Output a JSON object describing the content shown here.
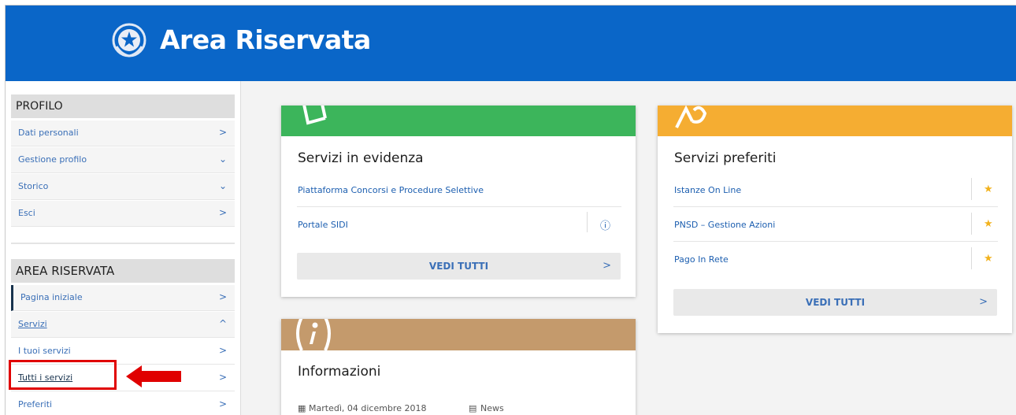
{
  "header": {
    "title": "Area Riservata",
    "bg_color": "#0a66c8",
    "emblem": "italian-republic-emblem-icon"
  },
  "sidebar": {
    "profilo": {
      "heading": "PROFILO",
      "items": [
        {
          "label": "Dati personali",
          "chevron": ">"
        },
        {
          "label": "Gestione profilo",
          "chevron": "⌄"
        },
        {
          "label": "Storico",
          "chevron": "⌄"
        },
        {
          "label": "Esci",
          "chevron": ">"
        }
      ]
    },
    "area": {
      "heading": "AREA RISERVATA",
      "items": [
        {
          "label": "Pagina iniziale",
          "chevron": ">"
        },
        {
          "label": "Servizi",
          "chevron": "^"
        },
        {
          "label": "I tuoi servizi",
          "chevron": ">"
        },
        {
          "label": "Tutti i servizi",
          "chevron": ">"
        },
        {
          "label": "Preferiti",
          "chevron": ">"
        }
      ]
    }
  },
  "cards": {
    "evidenza": {
      "band_color": "#3cb55b",
      "title": "Servizi in evidenza",
      "links": [
        "Piattaforma Concorsi e Procedure Selettive",
        "Portale SIDI"
      ],
      "info_icon": "ⓘ",
      "button": "VEDI TUTTI",
      "button_chevron": ">"
    },
    "preferiti": {
      "band_color": "#f5ad32",
      "title": "Servizi preferiti",
      "links": [
        "Istanze On Line",
        "PNSD – Gestione Azioni",
        "Pago In Rete"
      ],
      "star": "★",
      "button": "VEDI TUTTI",
      "button_chevron": ">"
    },
    "informazioni": {
      "band_color": "#c49a6c",
      "title": "Informazioni",
      "date": "Martedì, 04 dicembre 2018",
      "category": "News"
    }
  },
  "colors": {
    "accent": "#0a66c8",
    "link": "#1d5fb0",
    "annotation": "#e00000"
  }
}
